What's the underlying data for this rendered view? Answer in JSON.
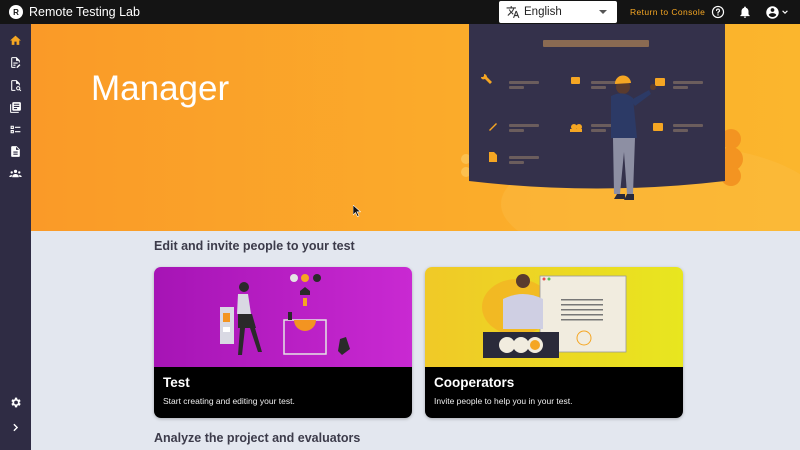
{
  "app": {
    "title": "Remote Testing Lab",
    "logo_letter": "R"
  },
  "header": {
    "language": "English",
    "return_label": "Return to Console"
  },
  "hero": {
    "title": "Manager"
  },
  "sections": {
    "edit_title": "Edit and invite people to your test",
    "analyze_title": "Analyze the project and evaluators"
  },
  "cards": {
    "test": {
      "title": "Test",
      "description": "Start creating and editing your test."
    },
    "cooperators": {
      "title": "Cooperators",
      "description": "Invite people to help you in your test."
    }
  },
  "colors": {
    "accent": "#f5a623",
    "sidebar": "#2f2c44",
    "topbar": "#141414",
    "test_card": "#b81ec4",
    "cooperators_card": "#e9dd22"
  },
  "sidebar_icons": [
    "home-icon",
    "edit-document-icon",
    "find-document-icon",
    "library-icon",
    "checklist-icon",
    "report-icon",
    "group-icon",
    "settings-icon",
    "chevron-right-icon"
  ]
}
